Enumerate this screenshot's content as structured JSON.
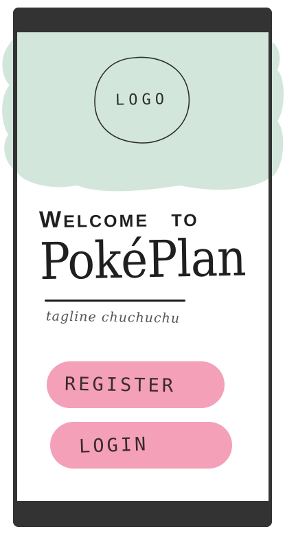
{
  "logo": {
    "label": "LOGO"
  },
  "welcome": {
    "prefix_big": "W",
    "prefix_rest": "ELCOME",
    "to_big": "T",
    "to_rest": "O"
  },
  "app": {
    "name": "PokéPlan",
    "tagline": "tagline chuchuchu"
  },
  "buttons": {
    "register": "REGISTER",
    "login": "LOGIN"
  },
  "colors": {
    "frame": "#333333",
    "header_blob": "#d3e6dc",
    "button": "#f3a0b8",
    "text": "#1f1f1f"
  }
}
